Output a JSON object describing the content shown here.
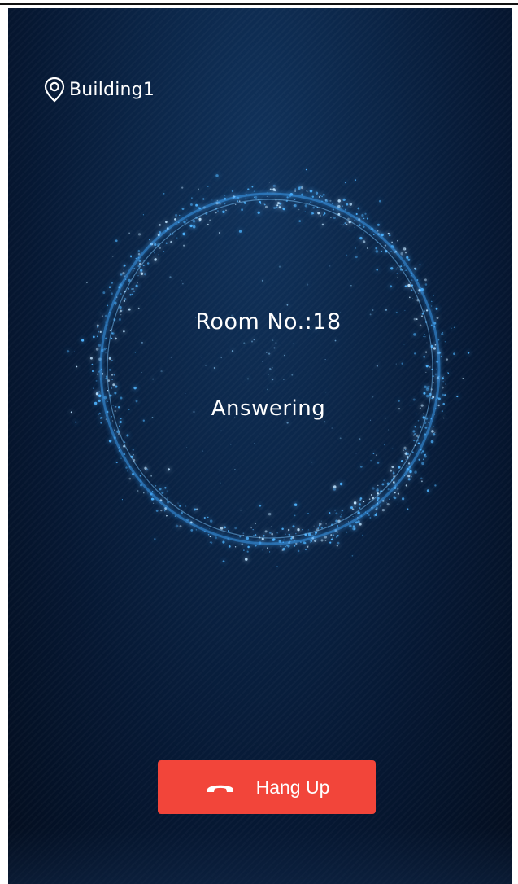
{
  "header": {
    "location": "Building1",
    "location_icon": "map-pin-icon"
  },
  "call": {
    "room_label": "Room No.:18",
    "status": "Answering"
  },
  "actions": {
    "hangup_label": "Hang Up",
    "hangup_icon": "phone-hangup-icon",
    "hangup_color": "#f2453a"
  },
  "theme": {
    "background": "#061833",
    "ring_color": "#3fa8ff"
  }
}
